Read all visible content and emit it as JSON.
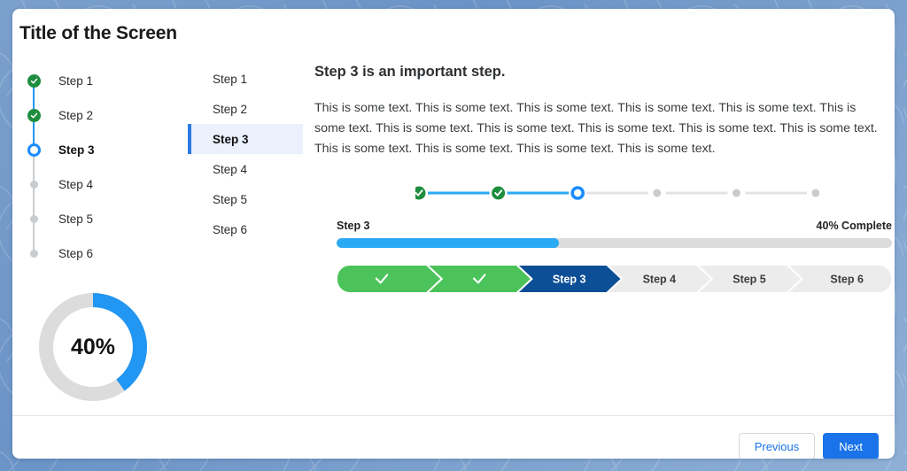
{
  "window": {
    "title": "Title of the Screen"
  },
  "vertical_stepper": {
    "name": "vertical-progress-stepper",
    "steps": [
      {
        "label": "Step 1",
        "state": "done"
      },
      {
        "label": "Step 2",
        "state": "done"
      },
      {
        "label": "Step 3",
        "state": "current"
      },
      {
        "label": "Step 4",
        "state": "todo"
      },
      {
        "label": "Step 5",
        "state": "todo"
      },
      {
        "label": "Step 6",
        "state": "todo"
      }
    ]
  },
  "donut": {
    "percent_label": "40%",
    "percent": 40,
    "fill_color": "#2196f3",
    "track_color": "#dcdcdc"
  },
  "tab_list": {
    "items": [
      {
        "label": "Step 1",
        "active": false
      },
      {
        "label": "Step 2",
        "active": false
      },
      {
        "label": "Step 3",
        "active": true
      },
      {
        "label": "Step 4",
        "active": false
      },
      {
        "label": "Step 5",
        "active": false
      },
      {
        "label": "Step 6",
        "active": false
      }
    ]
  },
  "main": {
    "heading": "Step 3 is an important step.",
    "body": "This is some text. This is some text. This is some text. This is some text. This is some text. This is some text. This is some text. This is some text. This is some text. This is some text. This is some text. This is some text. This is some text. This is some text. This is some text."
  },
  "horizontal_stepper": {
    "steps": [
      {
        "state": "done"
      },
      {
        "state": "done"
      },
      {
        "state": "current"
      },
      {
        "state": "todo"
      },
      {
        "state": "todo"
      },
      {
        "state": "todo"
      }
    ],
    "done_color": "#1e8e3e",
    "current_color": "#1a8cff",
    "todo_color": "#c9cccf",
    "active_line_color": "#2aaaf3",
    "inactive_line_color": "#e1e3e5"
  },
  "progress": {
    "left_label": "Step 3",
    "right_label": "40% Complete",
    "percent": 40,
    "fill_color": "#2aaaf3",
    "track_color": "#dcdcdc"
  },
  "chevron_bar": {
    "items": [
      {
        "label": "",
        "state": "done",
        "icon": "check-icon"
      },
      {
        "label": "",
        "state": "done",
        "icon": "check-icon"
      },
      {
        "label": "Step 3",
        "state": "current",
        "icon": ""
      },
      {
        "label": "Step 4",
        "state": "todo",
        "icon": ""
      },
      {
        "label": "Step 5",
        "state": "todo",
        "icon": ""
      },
      {
        "label": "Step 6",
        "state": "todo",
        "icon": ""
      }
    ],
    "done_color": "#4cc35a",
    "current_color": "#0d4f96",
    "todo_color": "#ececec",
    "done_text_color": "#ffffff",
    "current_text_color": "#ffffff",
    "todo_text_color": "#3a3d40"
  },
  "footer": {
    "previous_label": "Previous",
    "next_label": "Next",
    "primary_color": "#1a73e8"
  }
}
